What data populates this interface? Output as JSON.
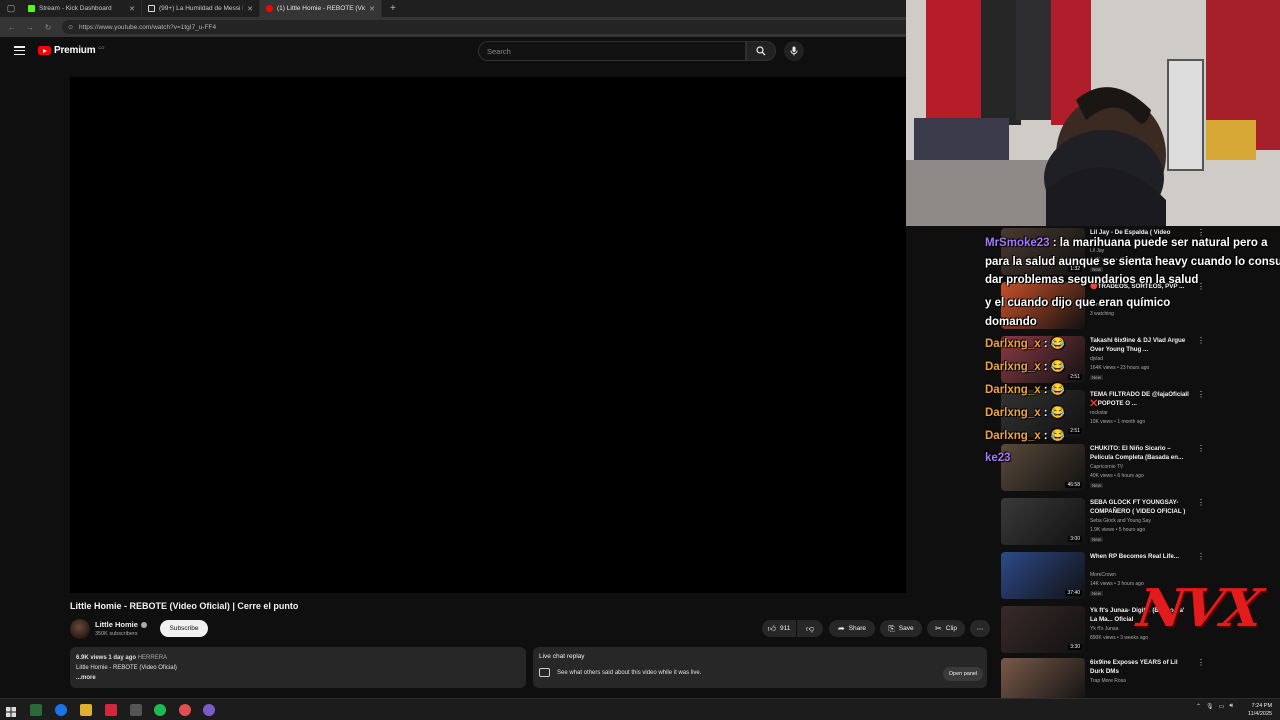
{
  "browser": {
    "tabs": [
      {
        "label": "Stream - Kick Dashboard",
        "color": "#53fc18"
      },
      {
        "label": "(99+) La Humildad de Messi El M...",
        "color": "#ffffff"
      },
      {
        "label": "(1) Little Homie - REBOTE (Video",
        "color": "#ff0000"
      }
    ],
    "url": "https://www.youtube.com/watch?v=1tgI7_u-FF4"
  },
  "masthead": {
    "logo_text": "Premium",
    "logo_sup": "CO",
    "search_placeholder": "Search"
  },
  "video": {
    "title": "Little Homie - REBOTE (Video Oficial) | Cerre el punto",
    "channel": "Little Homie",
    "subscribers": "350K subscribers",
    "subscribe_label": "Subscribe",
    "likes": "911",
    "share_label": "Share",
    "save_label": "Save",
    "clip_label": "Clip",
    "more_label": "⋯"
  },
  "description": {
    "views": "6.9K views",
    "age": "1 day ago",
    "tag": "HERRERA",
    "text": "Little Homie - REBOTE (Video Oficial)",
    "more": "...more"
  },
  "live_chat": {
    "heading": "Live chat replay",
    "subtitle": "See what others said about this video while it was live.",
    "open_label": "Open panel"
  },
  "chat_overlay": [
    {
      "user": "MrSmoke23",
      "sep": " : ",
      "msg": "la marihuana puede ser natural pero a",
      "ucls": "u1"
    },
    {
      "user": "",
      "sep": "",
      "msg": "para la salud aunque se sienta heavy cuando lo consu",
      "ucls": "u1"
    },
    {
      "user": "",
      "sep": "",
      "msg": "dar problemas segundarios en la salud",
      "ucls": "u1"
    },
    {
      "user": "",
      "sep": "",
      "msg": "y el cuando dijo que eran químico",
      "ucls": "u2"
    },
    {
      "user": "",
      "sep": "",
      "msg": "domando",
      "ucls": "u2"
    },
    {
      "user": "Darlxng_x",
      "sep": " : ",
      "msg": "😂",
      "ucls": "u2"
    },
    {
      "user": "Darlxng_x",
      "sep": " : ",
      "msg": "😂",
      "ucls": "u2"
    },
    {
      "user": "Darlxng_x",
      "sep": " : ",
      "msg": "😂",
      "ucls": "u2"
    },
    {
      "user": "Darlxng_x",
      "sep": " : ",
      "msg": "😂",
      "ucls": "u2"
    },
    {
      "user": "Darlxng_x",
      "sep": " : ",
      "msg": "😂",
      "ucls": "u2"
    },
    {
      "user": "ke23",
      "sep": "",
      "msg": "",
      "ucls": "u1"
    }
  ],
  "recommendations": [
    {
      "title": "Lil Jay - De Espalda ( Video",
      "channel": "Lil Jay",
      "views": "1.4K views • 48 minutes ago",
      "badge": "New",
      "duration": "1:32"
    },
    {
      "title": "🔴TRADEOS, SORTEOS, PVP ...",
      "channel": "Yunitax",
      "views": "3 watching",
      "badge": "",
      "duration": ""
    },
    {
      "title": "Takashi 6ix9ine & DJ Vlad Argue Over Young Thug ...",
      "channel": "djvlad",
      "views": "164K views • 23 hours ago",
      "badge": "New",
      "duration": "2:51"
    },
    {
      "title": "TEMA FILTRADO DE @lajaOficiall ❌POPOTE O ...",
      "channel": "rockstar",
      "views": "10K views • 1 month ago",
      "badge": "",
      "duration": "2:51"
    },
    {
      "title": "CHUKITO: El Niño Sicario – Película Completa (Basada en...",
      "channel": "Capricornio TV",
      "views": "40K views • 6 hours ago",
      "badge": "New",
      "duration": "46:58"
    },
    {
      "title": "SEBA GLOCK FT YOUNGSAY- COMPAÑERO ( VIDEO OFICIAL )",
      "channel": "Seba Glock and Young Say",
      "views": "1.9K views • 5 hours ago",
      "badge": "New",
      "duration": "3:00"
    },
    {
      "title": "When RP Becomes Real Life...",
      "channel": "MoreCrown",
      "views": "14K views • 3 hours ago",
      "badge": "New",
      "duration": "37:40"
    },
    {
      "title": "Yk ft's Junaa- Digit... (Bosito Pa' La Ma... Oficial",
      "channel": "Yk ft's Junaa",
      "views": "890K views • 3 weeks ago",
      "badge": "",
      "duration": "3:30"
    },
    {
      "title": "6ix9ine Exposes YEARS of Lil Durk DMs",
      "channel": "Trap More Rosa",
      "views": "",
      "badge": "",
      "duration": ""
    }
  ],
  "overlay_logo": "NVX",
  "taskbar": {
    "time": "7:24 PM",
    "date": "11/4/2025"
  },
  "colors": {
    "yt_red": "#ff0000",
    "background": "#0f0f0f",
    "chip": "#272727"
  }
}
